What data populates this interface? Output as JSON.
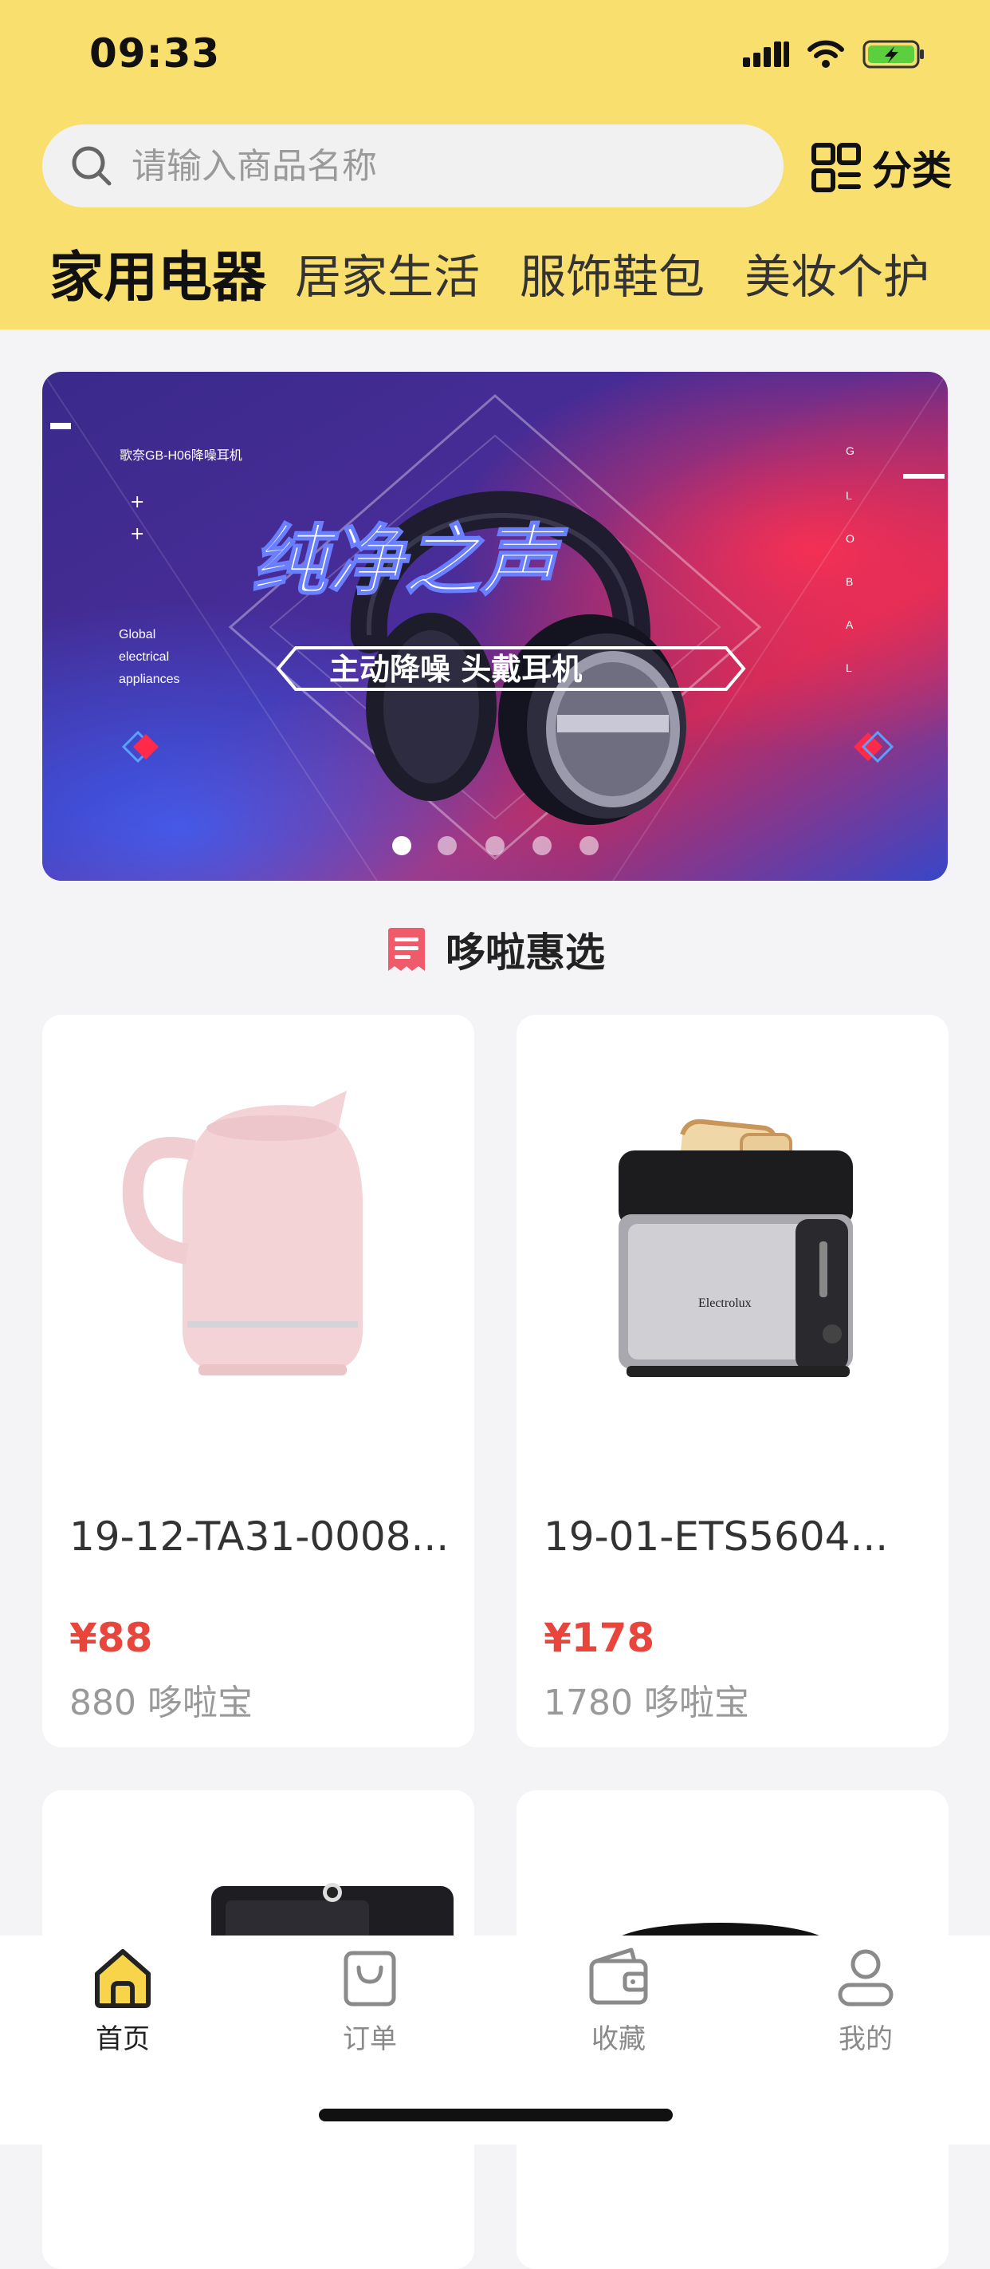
{
  "status_bar": {
    "time": "09:33"
  },
  "search": {
    "placeholder": "请输入商品名称"
  },
  "category_button": {
    "label": "分类"
  },
  "tabs": [
    {
      "label": "家用电器",
      "active": true
    },
    {
      "label": "居家生活",
      "active": false
    },
    {
      "label": "服饰鞋包",
      "active": false
    },
    {
      "label": "美妆个护",
      "active": false
    }
  ],
  "banner": {
    "brand_caption": "歌奈GB-H06降噪耳机",
    "headline": "纯净之声",
    "subline": "主动降噪 头戴耳机",
    "side_text": [
      "Global",
      "electrical",
      "appliances"
    ],
    "vertical_text": "GLOBAL",
    "dots_total": 5,
    "dots_active": 1
  },
  "section": {
    "title": "哆啦惠选",
    "icon": "receipt-icon"
  },
  "products": [
    {
      "name": "19-12-TA31-0008...",
      "price": "¥88",
      "points": "880 哆啦宝",
      "image": "pink-kettle"
    },
    {
      "name": "19-01-ETS5604...",
      "price": "¥178",
      "points": "1780 哆啦宝",
      "image": "toaster"
    },
    {
      "name": "",
      "price": "",
      "points": "",
      "image": "microwave"
    },
    {
      "name": "",
      "price": "",
      "points": "",
      "image": "dark-appliance"
    }
  ],
  "tabbar": [
    {
      "label": "首页",
      "icon": "home-icon",
      "active": true
    },
    {
      "label": "订单",
      "icon": "bag-icon",
      "active": false
    },
    {
      "label": "收藏",
      "icon": "wallet-icon",
      "active": false
    },
    {
      "label": "我的",
      "icon": "user-icon",
      "active": false
    }
  ],
  "colors": {
    "header_bg": "#f9df6d",
    "price": "#e8453c",
    "page_bg": "#f4f4f6",
    "active_tab_icon": "#f7d44a"
  }
}
